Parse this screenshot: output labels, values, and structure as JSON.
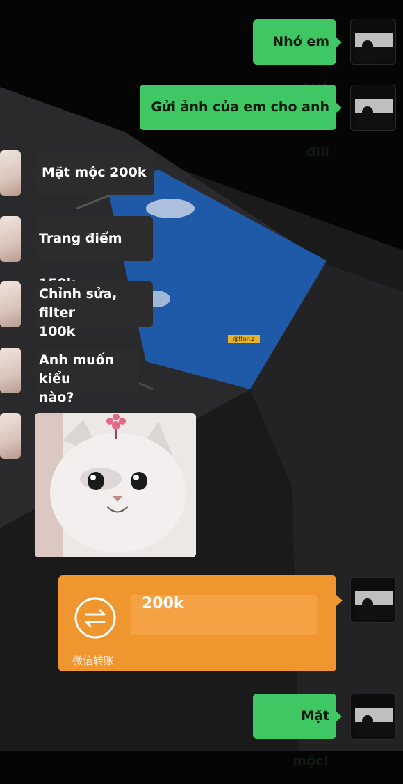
{
  "messages": [
    {
      "side": "right",
      "text": "Nhớ em quá"
    },
    {
      "side": "right",
      "text": "Gửi ảnh của em cho anh điii"
    },
    {
      "side": "left",
      "text": "Mặt mộc 200k"
    },
    {
      "side": "left",
      "text": "Trang điểm 150k"
    },
    {
      "side": "left",
      "lines": [
        "Chỉnh sửa, filter",
        "100k"
      ]
    },
    {
      "side": "left",
      "lines": [
        "Anh muốn kiểu",
        "nào?"
      ]
    },
    {
      "side": "left",
      "sticker": "cat-sticker"
    },
    {
      "side": "right",
      "transfer": {
        "amount": "200k",
        "caption": "微信转账",
        "icon": "transfer-icon"
      }
    },
    {
      "side": "right",
      "text": "Mặt mộc!"
    }
  ],
  "watermark": "@ttnn.z",
  "colors": {
    "me_bubble": "#3fc763",
    "her_bubble": "#2c2c2c",
    "transfer": "#f0962f",
    "background": "#050505",
    "sky": "#1e5aa8"
  }
}
